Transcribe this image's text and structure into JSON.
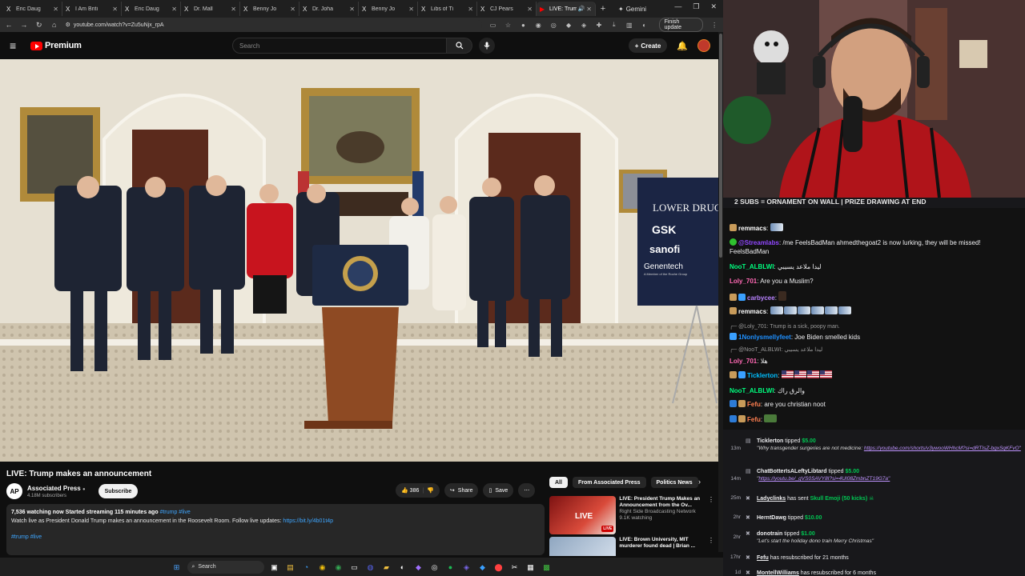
{
  "browser": {
    "tabs": [
      {
        "favicon": "X",
        "title": "Eric Daug"
      },
      {
        "favicon": "X",
        "title": "I Am Briti"
      },
      {
        "favicon": "X",
        "title": "Eric Daug"
      },
      {
        "favicon": "X",
        "title": "Dr. Mall"
      },
      {
        "favicon": "X",
        "title": "Benny Jo"
      },
      {
        "favicon": "X",
        "title": "Dr. Joha"
      },
      {
        "favicon": "X",
        "title": "Benny Jo"
      },
      {
        "favicon": "X",
        "title": "Libs of Ti"
      },
      {
        "favicon": "X",
        "title": "CJ Pears"
      },
      {
        "favicon": "▶",
        "title": "LIVE: Trum"
      }
    ],
    "gemini_label": "Gemini",
    "url": "youtube.com/watch?v=Zu5uNjx_rpA",
    "finish_update_label": "Finish update"
  },
  "youtube": {
    "logo_text": "Premium",
    "search_placeholder": "Search",
    "create_label": "Create"
  },
  "video": {
    "title": "LIVE: Trump makes an announcement",
    "channel_initials": "AP",
    "channel_name": "Associated Press",
    "subscribers": "4.18M subscribers",
    "subscribe_label": "Subscribe",
    "likes": "386",
    "share_label": "Share",
    "save_label": "Save",
    "stats": "7,536 watching now  Started streaming 115 minutes ago",
    "stats_tags": "#trump #live",
    "description": "Watch live as President Donald Trump makes an announcement in the Roosevelt Room. Follow live updates:",
    "description_link": "https://bit.ly/4b01t4p",
    "hashtags": "#trump #live",
    "scene_banner": {
      "heading": "LOWER DRUG",
      "brands": [
        "GSK",
        "sanofi",
        "Genentech"
      ],
      "genentech_tagline": "A Member of the Roche Group"
    }
  },
  "recommended": {
    "chips": [
      "All",
      "From Associated Press",
      "Politics News"
    ],
    "items": [
      {
        "title": "LIVE: President Trump Makes an Announcement from the Ov...",
        "channel": "Right Side Broadcasting Network",
        "meta": "9.1K watching",
        "badge": "LIVE",
        "thumb_text": "LIVE"
      },
      {
        "title": "LIVE: Brown University, MIT murderer found dead | Brian ...",
        "channel": "",
        "meta": "",
        "badge": "",
        "thumb_text": ""
      }
    ]
  },
  "taskbar": {
    "search_label": "Search"
  },
  "stream": {
    "banner": "2 SUBS = ORNAMENT ON WALL | PRIZE DRAWING AT END",
    "chat": [
      {
        "user": "remmacs",
        "user_color": "#ffffff",
        "text": ""
      },
      {
        "user": "@Streamlabs",
        "user_color": "#9147ff",
        "text": "/me FeelsBadMan ahmedthegoat2 is now lurking, they will be missed! FeelsBadMan"
      },
      {
        "user": "NooT_ALBLWI",
        "user_color": "#00ff7f",
        "text": "ليدا ملاعد يسيبي"
      },
      {
        "user": "Loly_701",
        "user_color": "#ff69b4",
        "text": "Are you a Muslim?"
      },
      {
        "user": "carbycee",
        "user_color": "#b882ff",
        "text": ""
      },
      {
        "user": "remmacs",
        "user_color": "#ffffff",
        "text": ""
      },
      {
        "reply": "@Loly_701: Trump is a sick, poopy man."
      },
      {
        "user": "1Nonlysmellyfeet",
        "user_color": "#1e90ff",
        "text": "Joe Biden smelled kids"
      },
      {
        "reply": "@NooT_ALBLWI: ليدا ملاعد يسيبي"
      },
      {
        "user": "Loly_701",
        "user_color": "#ff69b4",
        "text": "هلا"
      },
      {
        "user": "Ticklerton",
        "user_color": "#00bfff",
        "text": ""
      },
      {
        "user": "NooT_ALBLWI",
        "user_color": "#00ff7f",
        "text": "والرق راك"
      },
      {
        "user": "Fefu",
        "user_color": "#ff7f50",
        "text": "are you christian noot"
      },
      {
        "user": "Fefu",
        "user_color": "#ff7f50",
        "text": ""
      }
    ],
    "events": [
      {
        "time": "13m",
        "user": "Ticklerton",
        "action": "tipped",
        "amount": "$5.00",
        "note": "\"Why transgender surgeries are not medicine:",
        "link": "https://youtube.com/shorts/v3ywooWHhcM?si=dRTIsZ-bgxSqKFvO\""
      },
      {
        "time": "14m",
        "user": "ChatBotterIsALeftyLibtard",
        "action": "tipped",
        "amount": "$5.00",
        "note": "\"",
        "link": "https://youtu.be/_gVS0SAVY8I?si=4UI08ZmbnZT19G7a\""
      },
      {
        "time": "25m",
        "user": "Ladyclinks",
        "action": "has sent",
        "amount": "Skull Emoji (50 kicks)",
        "note": "",
        "link": ""
      },
      {
        "time": "2hr",
        "user": "HerntDawg",
        "action": "tipped",
        "amount": "$10.00",
        "note": "",
        "link": ""
      },
      {
        "time": "2hr",
        "user": "donotrain",
        "action": "tipped",
        "amount": "$1.00",
        "note": "\"Let's start the holiday dono train Merry Christmas\"",
        "link": ""
      },
      {
        "time": "17hr",
        "user": "Fefu",
        "action": "has resubscribed for 21 months",
        "amount": "",
        "note": "",
        "link": ""
      },
      {
        "time": "1d",
        "user": "MontellWilliams",
        "action": "has resubscribed for 6 months",
        "amount": "",
        "note": "",
        "link": ""
      }
    ]
  }
}
